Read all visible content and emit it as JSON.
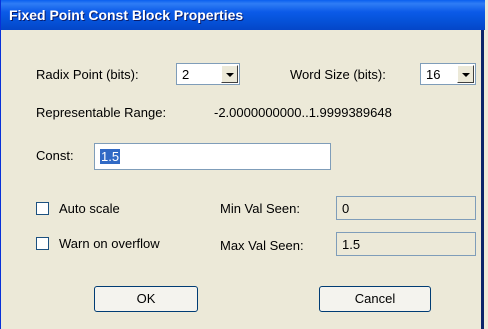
{
  "window": {
    "title": "Fixed Point Const Block Properties"
  },
  "radix": {
    "label": "Radix Point (bits):",
    "value": "2"
  },
  "word_size": {
    "label": "Word Size (bits):",
    "value": "16"
  },
  "range": {
    "label": "Representable Range:",
    "value": "-2.0000000000..1.9999389648"
  },
  "const": {
    "label": "Const:",
    "value": "1.5"
  },
  "auto_scale": {
    "label": "Auto scale",
    "checked": false
  },
  "warn_overflow": {
    "label": "Warn on overflow",
    "checked": false
  },
  "min_val": {
    "label": "Min Val Seen:",
    "value": "0"
  },
  "max_val": {
    "label": "Max Val Seen:",
    "value": "1.5"
  },
  "buttons": {
    "ok": "OK",
    "cancel": "Cancel"
  },
  "icons": {
    "dropdown": "chevron-down-icon"
  },
  "colors": {
    "titlebar": "#0552d8",
    "face": "#ece9d8",
    "selection": "#316ac5"
  }
}
